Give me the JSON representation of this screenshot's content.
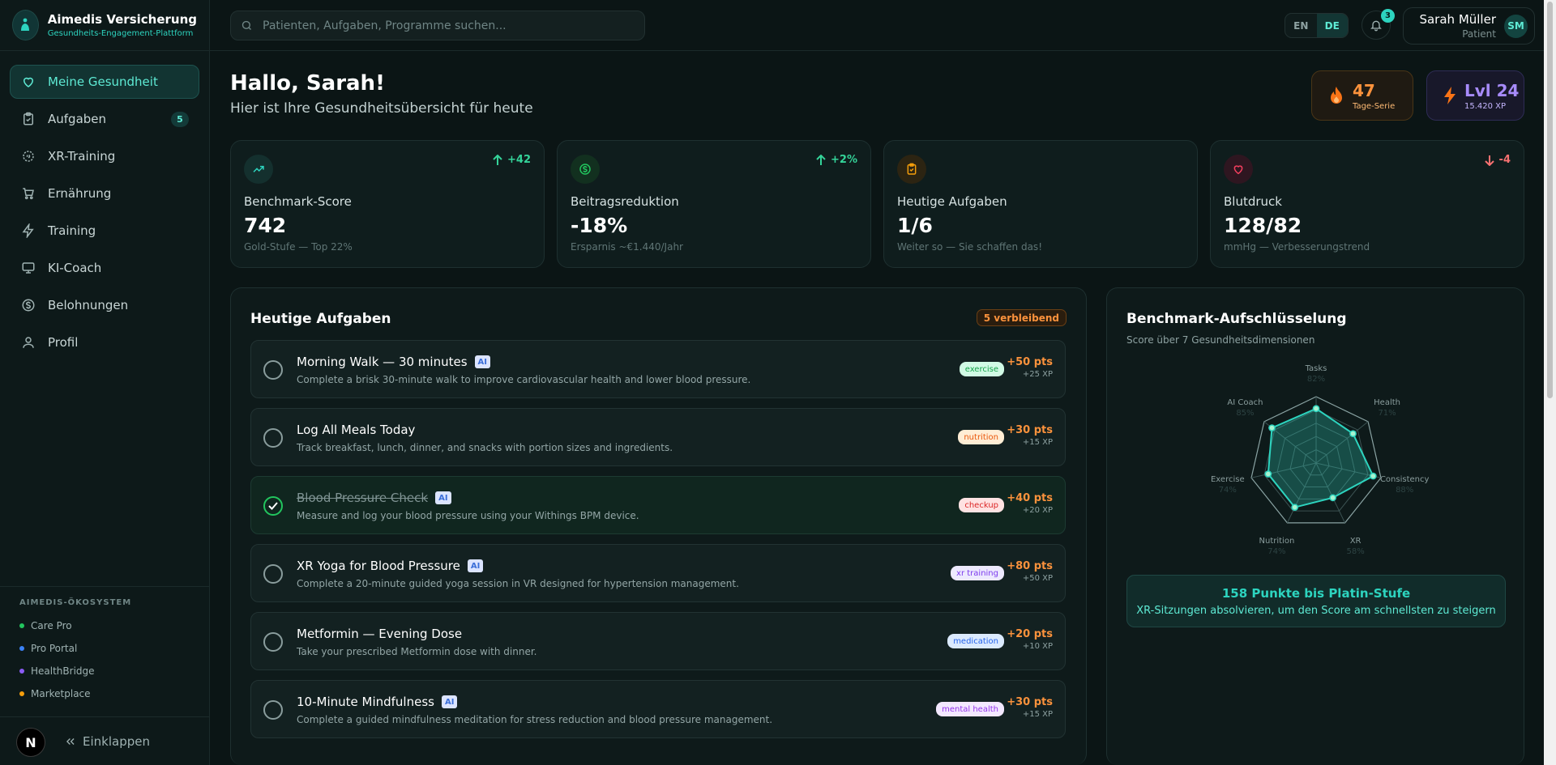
{
  "brand": {
    "title": "Aimedis Versicherung",
    "subtitle": "Gesundheits-Engagement-Plattform"
  },
  "sidebar": {
    "items": [
      {
        "label": "Meine Gesundheit",
        "icon": "heart-icon",
        "active": true
      },
      {
        "label": "Aufgaben",
        "icon": "clipboard-icon",
        "badge": "5"
      },
      {
        "label": "XR-Training",
        "icon": "xr-icon"
      },
      {
        "label": "Ernährung",
        "icon": "cart-icon"
      },
      {
        "label": "Training",
        "icon": "bolt-icon"
      },
      {
        "label": "KI-Coach",
        "icon": "monitor-icon"
      },
      {
        "label": "Belohnungen",
        "icon": "coin-icon"
      },
      {
        "label": "Profil",
        "icon": "user-icon"
      }
    ],
    "ecosystem_title": "AIMEDIS-ÖKOSYSTEM",
    "ecosystem": [
      {
        "label": "Care Pro",
        "color": "#22c55e"
      },
      {
        "label": "Pro Portal",
        "color": "#3b82f6"
      },
      {
        "label": "HealthBridge",
        "color": "#8b5cf6"
      },
      {
        "label": "Marketplace",
        "color": "#f59e0b"
      }
    ],
    "avatar_letter": "N",
    "collapse_label": "Einklappen"
  },
  "topbar": {
    "search_placeholder": "Patienten, Aufgaben, Programme suchen...",
    "lang_en": "EN",
    "lang_de": "DE",
    "notifications": "3",
    "user_name": "Sarah Müller",
    "user_role": "Patient",
    "user_initials": "SM"
  },
  "greeting": {
    "title": "Hallo, Sarah!",
    "subtitle": "Hier ist Ihre Gesundheitsübersicht für heute"
  },
  "streak": {
    "value": "47",
    "label": "Tage-Serie"
  },
  "level": {
    "value": "Lvl 24",
    "label": "15.420 XP"
  },
  "stats": [
    {
      "label": "Benchmark-Score",
      "value": "742",
      "sub": "Gold-Stufe — Top 22%",
      "delta": "+42",
      "trend": "up",
      "color": "#2dd4bf"
    },
    {
      "label": "Beitragsreduktion",
      "value": "-18%",
      "sub": "Ersparnis ~€1.440/Jahr",
      "delta": "+2%",
      "trend": "up",
      "color": "#22c55e"
    },
    {
      "label": "Heutige Aufgaben",
      "value": "1/6",
      "sub": "Weiter so — Sie schaffen das!",
      "delta": "",
      "trend": "",
      "color": "#f59e0b"
    },
    {
      "label": "Blutdruck",
      "value": "128/82",
      "sub": "mmHg — Verbesserungstrend",
      "delta": "-4",
      "trend": "down",
      "color": "#f43f5e"
    }
  ],
  "tasks_panel": {
    "title": "Heutige Aufgaben",
    "remaining": "5 verbleibend",
    "ai_label": "AI",
    "tasks": [
      {
        "title": "Morning Walk — 30 minutes",
        "desc": "Complete a brisk 30-minute walk to improve cardiovascular health and lower blood pressure.",
        "tag": "exercise",
        "pts": "+50 pts",
        "xp": "+25 XP",
        "ai": true,
        "done": false
      },
      {
        "title": "Log All Meals Today",
        "desc": "Track breakfast, lunch, dinner, and snacks with portion sizes and ingredients.",
        "tag": "nutrition",
        "pts": "+30 pts",
        "xp": "+15 XP",
        "ai": false,
        "done": false
      },
      {
        "title": "Blood Pressure Check",
        "desc": "Measure and log your blood pressure using your Withings BPM device.",
        "tag": "checkup",
        "pts": "+40 pts",
        "xp": "+20 XP",
        "ai": true,
        "done": true
      },
      {
        "title": "XR Yoga for Blood Pressure",
        "desc": "Complete a 20-minute guided yoga session in VR designed for hypertension management.",
        "tag": "xr training",
        "pts": "+80 pts",
        "xp": "+50 XP",
        "ai": true,
        "done": false
      },
      {
        "title": "Metformin — Evening Dose",
        "desc": "Take your prescribed Metformin dose with dinner.",
        "tag": "medication",
        "pts": "+20 pts",
        "xp": "+10 XP",
        "ai": false,
        "done": false
      },
      {
        "title": "10-Minute Mindfulness",
        "desc": "Complete a guided mindfulness meditation for stress reduction and blood pressure management.",
        "tag": "mental health",
        "pts": "+30 pts",
        "xp": "+15 XP",
        "ai": true,
        "done": false
      }
    ],
    "tag_colors": {
      "exercise": {
        "bg": "#d1fae5",
        "fg": "#16a34a"
      },
      "nutrition": {
        "bg": "#ffedd5",
        "fg": "#ea580c"
      },
      "checkup": {
        "bg": "#fee2e2",
        "fg": "#dc2626"
      },
      "xr training": {
        "bg": "#ede9fe",
        "fg": "#7c3aed"
      },
      "medication": {
        "bg": "#dbeafe",
        "fg": "#2563eb"
      },
      "mental health": {
        "bg": "#f3e8ff",
        "fg": "#9333ea"
      }
    }
  },
  "benchmark": {
    "title": "Benchmark-Aufschlüsselung",
    "subtitle": "Score über 7 Gesundheitsdimensionen",
    "platin_title": "158 Punkte bis Platin-Stufe",
    "platin_sub": "XR-Sitzungen absolvieren, um den Score am schnellsten zu steigern"
  },
  "chart_data": {
    "type": "radar",
    "categories": [
      "Tasks",
      "Health",
      "Consistency",
      "XR",
      "Nutrition",
      "Exercise",
      "AI Coach"
    ],
    "values": [
      82,
      71,
      88,
      58,
      74,
      74,
      85
    ],
    "value_labels": [
      "82%",
      "71%",
      "88%",
      "58%",
      "74%",
      "74%",
      "85%"
    ],
    "range": [
      0,
      100
    ],
    "rings": 5,
    "color": "#2dd4bf"
  }
}
